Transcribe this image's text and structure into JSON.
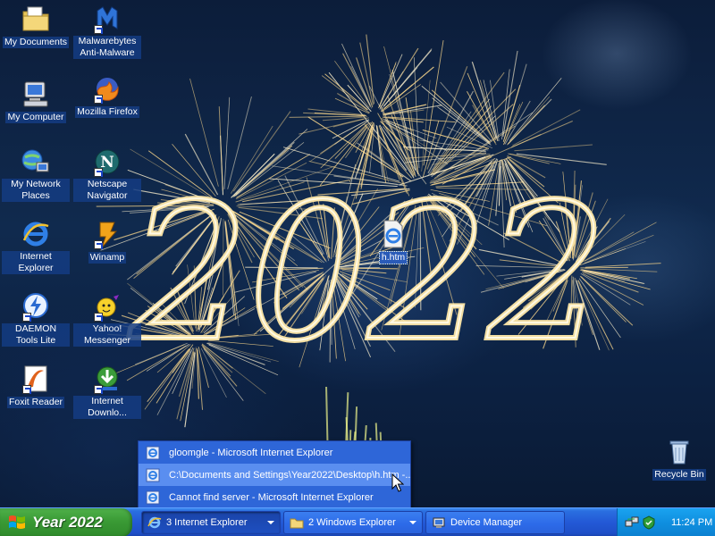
{
  "desktop": {
    "wallpaper_text": "2022",
    "icons": [
      {
        "label": "My Documents",
        "icon": "folder-documents-icon"
      },
      {
        "label": "Malwarebytes Anti-Malware",
        "icon": "malwarebytes-icon"
      },
      {
        "label": "My Computer",
        "icon": "computer-icon"
      },
      {
        "label": "Mozilla Firefox",
        "icon": "firefox-icon"
      },
      {
        "label": "My Network Places",
        "icon": "network-icon"
      },
      {
        "label": "Netscape Navigator",
        "icon": "netscape-icon"
      },
      {
        "label": "Internet Explorer",
        "icon": "ie-icon"
      },
      {
        "label": "Winamp",
        "icon": "winamp-icon"
      },
      {
        "label": "DAEMON Tools Lite",
        "icon": "daemon-tools-icon"
      },
      {
        "label": "Yahoo! Messenger",
        "icon": "yahoo-messenger-icon"
      },
      {
        "label": "Foxit Reader",
        "icon": "foxit-icon"
      },
      {
        "label": "Internet Downlo...",
        "icon": "download-manager-icon"
      },
      {
        "label": "h.htm",
        "icon": "html-file-icon"
      },
      {
        "label": "Recycle Bin",
        "icon": "recycle-bin-icon"
      }
    ]
  },
  "group_menu": {
    "items": [
      {
        "label": "gloomgle - Microsoft Internet Explorer"
      },
      {
        "label": "C:\\Documents and Settings\\Year2022\\Desktop\\h.htm -..."
      },
      {
        "label": "Cannot find server - Microsoft Internet Explorer"
      }
    ]
  },
  "taskbar": {
    "start_label": "Year 2022",
    "tasks": [
      {
        "label": "3 Internet Explorer"
      },
      {
        "label": "2 Windows Explorer"
      },
      {
        "label": "Device Manager"
      }
    ],
    "clock": "11:24 PM"
  },
  "colors": {
    "taskbar": "#2359d6",
    "start": "#3a9a35",
    "tray": "#0f8fe0",
    "icon_label_bg": "#143c82"
  }
}
